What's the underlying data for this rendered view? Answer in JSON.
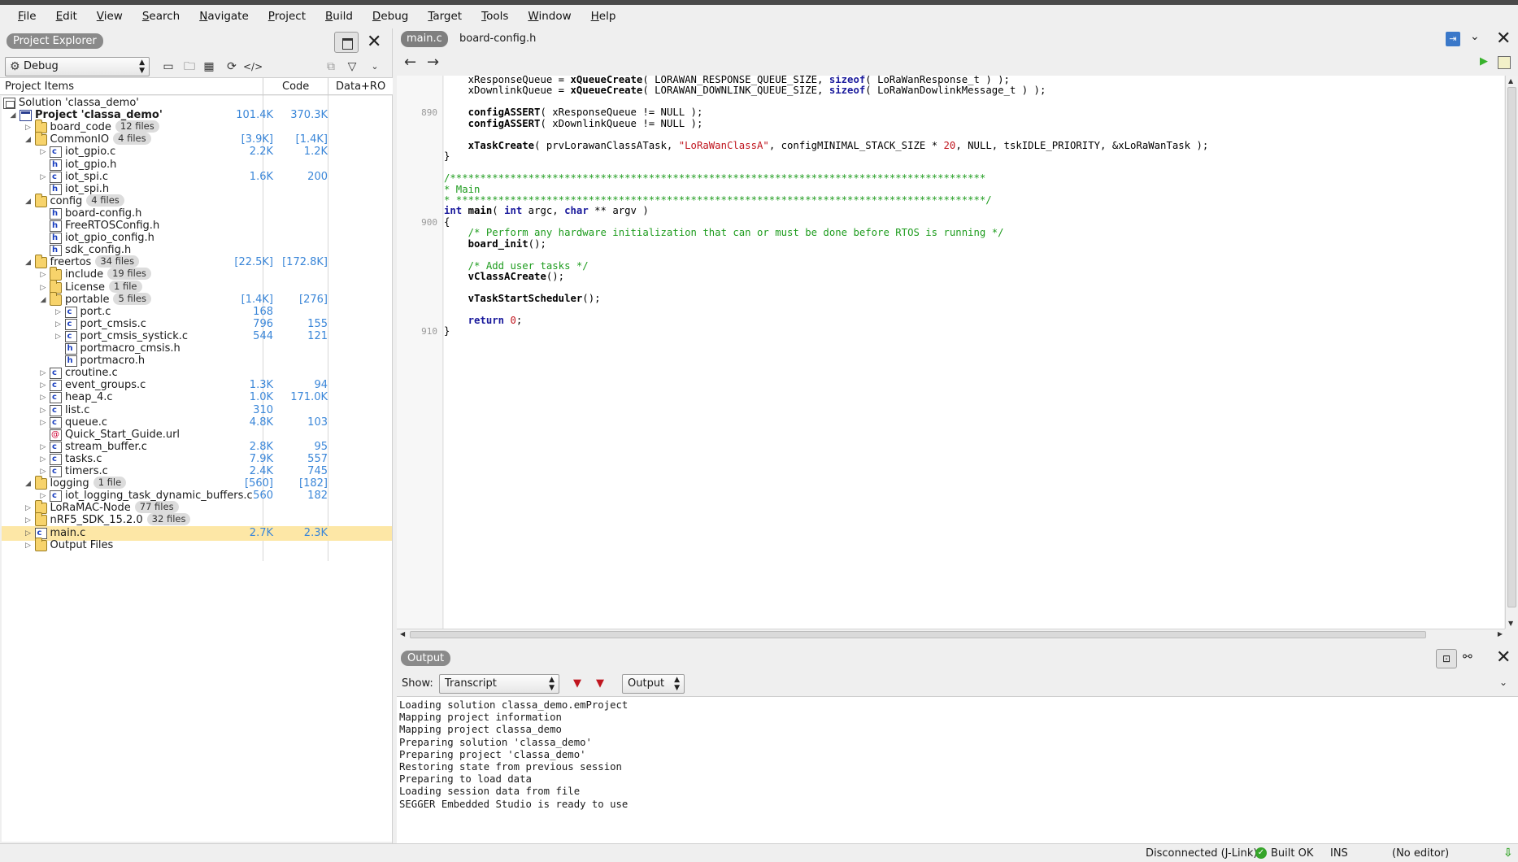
{
  "menu": [
    "File",
    "Edit",
    "View",
    "Search",
    "Navigate",
    "Project",
    "Build",
    "Debug",
    "Target",
    "Tools",
    "Window",
    "Help"
  ],
  "project_explorer": {
    "title": "Project Explorer",
    "configuration": "Debug",
    "columns": {
      "items": "Project Items",
      "code": "Code",
      "data": "Data+RO"
    },
    "tree": [
      {
        "name": "Solution 'classa_demo'",
        "level": 0,
        "icon": "solution-icon",
        "twisty": "",
        "badge": "",
        "code": "",
        "data": "",
        "bold": false
      },
      {
        "name": "Project 'classa_demo'",
        "level": 0,
        "icon": "project-icon",
        "twisty": "open",
        "badge": "",
        "code": "101.4K",
        "data": "370.3K",
        "bold": true
      },
      {
        "name": "board_code",
        "level": 1,
        "icon": "folder-icon",
        "twisty": "closed",
        "badge": "12 files",
        "code": "",
        "data": "",
        "bold": false
      },
      {
        "name": "CommonIO",
        "level": 1,
        "icon": "folder-icon",
        "twisty": "open",
        "badge": "4 files",
        "code": "[3.9K]",
        "data": "[1.4K]",
        "bold": false
      },
      {
        "name": "iot_gpio.c",
        "level": 2,
        "icon": "c-file-icon",
        "twisty": "closed",
        "badge": "",
        "code": "2.2K",
        "data": "1.2K",
        "bold": false
      },
      {
        "name": "iot_gpio.h",
        "level": 2,
        "icon": "h-file-icon",
        "twisty": "",
        "badge": "",
        "code": "",
        "data": "",
        "bold": false
      },
      {
        "name": "iot_spi.c",
        "level": 2,
        "icon": "c-file-icon",
        "twisty": "closed",
        "badge": "",
        "code": "1.6K",
        "data": "200",
        "bold": false
      },
      {
        "name": "iot_spi.h",
        "level": 2,
        "icon": "h-file-icon",
        "twisty": "",
        "badge": "",
        "code": "",
        "data": "",
        "bold": false
      },
      {
        "name": "config",
        "level": 1,
        "icon": "folder-icon",
        "twisty": "open",
        "badge": "4 files",
        "code": "",
        "data": "",
        "bold": false
      },
      {
        "name": "board-config.h",
        "level": 2,
        "icon": "h-file-icon",
        "twisty": "",
        "badge": "",
        "code": "",
        "data": "",
        "bold": false
      },
      {
        "name": "FreeRTOSConfig.h",
        "level": 2,
        "icon": "h-file-icon",
        "twisty": "",
        "badge": "",
        "code": "",
        "data": "",
        "bold": false
      },
      {
        "name": "iot_gpio_config.h",
        "level": 2,
        "icon": "h-file-icon",
        "twisty": "",
        "badge": "",
        "code": "",
        "data": "",
        "bold": false
      },
      {
        "name": "sdk_config.h",
        "level": 2,
        "icon": "h-file-icon",
        "twisty": "",
        "badge": "",
        "code": "",
        "data": "",
        "bold": false
      },
      {
        "name": "freertos",
        "level": 1,
        "icon": "folder-icon",
        "twisty": "open",
        "badge": "34 files",
        "code": "[22.5K]",
        "data": "[172.8K]",
        "bold": false
      },
      {
        "name": "include",
        "level": 2,
        "icon": "folder-icon",
        "twisty": "closed",
        "badge": "19 files",
        "code": "",
        "data": "",
        "bold": false
      },
      {
        "name": "License",
        "level": 2,
        "icon": "folder-icon",
        "twisty": "closed",
        "badge": "1 file",
        "code": "",
        "data": "",
        "bold": false
      },
      {
        "name": "portable",
        "level": 2,
        "icon": "folder-icon",
        "twisty": "open",
        "badge": "5 files",
        "code": "[1.4K]",
        "data": "[276]",
        "bold": false
      },
      {
        "name": "port.c",
        "level": 3,
        "icon": "c-file-icon",
        "twisty": "closed",
        "badge": "",
        "code": "168",
        "data": "",
        "bold": false
      },
      {
        "name": "port_cmsis.c",
        "level": 3,
        "icon": "c-file-icon",
        "twisty": "closed",
        "badge": "",
        "code": "796",
        "data": "155",
        "bold": false
      },
      {
        "name": "port_cmsis_systick.c",
        "level": 3,
        "icon": "c-file-icon",
        "twisty": "closed",
        "badge": "",
        "code": "544",
        "data": "121",
        "bold": false
      },
      {
        "name": "portmacro_cmsis.h",
        "level": 3,
        "icon": "h-file-icon",
        "twisty": "",
        "badge": "",
        "code": "",
        "data": "",
        "bold": false
      },
      {
        "name": "portmacro.h",
        "level": 3,
        "icon": "h-file-icon",
        "twisty": "",
        "badge": "",
        "code": "",
        "data": "",
        "bold": false
      },
      {
        "name": "croutine.c",
        "level": 2,
        "icon": "c-file-icon",
        "twisty": "closed",
        "badge": "",
        "code": "",
        "data": "",
        "bold": false
      },
      {
        "name": "event_groups.c",
        "level": 2,
        "icon": "c-file-icon",
        "twisty": "closed",
        "badge": "",
        "code": "1.3K",
        "data": "94",
        "bold": false
      },
      {
        "name": "heap_4.c",
        "level": 2,
        "icon": "c-file-icon",
        "twisty": "closed",
        "badge": "",
        "code": "1.0K",
        "data": "171.0K",
        "bold": false
      },
      {
        "name": "list.c",
        "level": 2,
        "icon": "c-file-icon",
        "twisty": "closed",
        "badge": "",
        "code": "310",
        "data": "",
        "bold": false
      },
      {
        "name": "queue.c",
        "level": 2,
        "icon": "c-file-icon",
        "twisty": "closed",
        "badge": "",
        "code": "4.8K",
        "data": "103",
        "bold": false
      },
      {
        "name": "Quick_Start_Guide.url",
        "level": 2,
        "icon": "url-file-icon",
        "twisty": "",
        "badge": "",
        "code": "",
        "data": "",
        "bold": false
      },
      {
        "name": "stream_buffer.c",
        "level": 2,
        "icon": "c-file-icon",
        "twisty": "closed",
        "badge": "",
        "code": "2.8K",
        "data": "95",
        "bold": false
      },
      {
        "name": "tasks.c",
        "level": 2,
        "icon": "c-file-icon",
        "twisty": "closed",
        "badge": "",
        "code": "7.9K",
        "data": "557",
        "bold": false
      },
      {
        "name": "timers.c",
        "level": 2,
        "icon": "c-file-icon",
        "twisty": "closed",
        "badge": "",
        "code": "2.4K",
        "data": "745",
        "bold": false
      },
      {
        "name": "logging",
        "level": 1,
        "icon": "folder-icon",
        "twisty": "open",
        "badge": "1 file",
        "code": "[560]",
        "data": "[182]",
        "bold": false
      },
      {
        "name": "iot_logging_task_dynamic_buffers.c",
        "level": 2,
        "icon": "c-file-icon",
        "twisty": "closed",
        "badge": "",
        "code": "560",
        "data": "182",
        "bold": false
      },
      {
        "name": "LoRaMAC-Node",
        "level": 1,
        "icon": "folder-icon",
        "twisty": "closed",
        "badge": "77 files",
        "code": "",
        "data": "",
        "bold": false
      },
      {
        "name": "nRF5_SDK_15.2.0",
        "level": 1,
        "icon": "folder-icon",
        "twisty": "closed",
        "badge": "32 files",
        "code": "",
        "data": "",
        "bold": false
      },
      {
        "name": "main.c",
        "level": 1,
        "icon": "c-file-icon",
        "twisty": "closed",
        "badge": "",
        "code": "2.7K",
        "data": "2.3K",
        "bold": false,
        "selected": true
      },
      {
        "name": "Output Files",
        "level": 1,
        "icon": "folder-icon",
        "twisty": "closed",
        "badge": "",
        "code": "",
        "data": "",
        "bold": false
      }
    ]
  },
  "editor": {
    "tabs": [
      "main.c",
      "board-config.h"
    ],
    "active_tab": "main.c",
    "line_numbers": [
      {
        "row": 3,
        "n": "890"
      },
      {
        "row": 13,
        "n": "900"
      },
      {
        "row": 23,
        "n": "910"
      }
    ],
    "lines": [
      [
        [
          "    xResponseQueue = ",
          ""
        ],
        [
          "xQueueCreate",
          "fn"
        ],
        [
          "( LORAWAN_RESPONSE_QUEUE_SIZE, ",
          ""
        ],
        [
          "sizeof",
          "kw"
        ],
        [
          "( LoRaWanResponse_t ) );",
          ""
        ]
      ],
      [
        [
          "    xDownlinkQueue = ",
          ""
        ],
        [
          "xQueueCreate",
          "fn"
        ],
        [
          "( LORAWAN_DOWNLINK_QUEUE_SIZE, ",
          ""
        ],
        [
          "sizeof",
          "kw"
        ],
        [
          "( LoRaWanDowlinkMessage_t ) );",
          ""
        ]
      ],
      [],
      [
        [
          "    ",
          ""
        ],
        [
          "configASSERT",
          "fn"
        ],
        [
          "( xResponseQueue != NULL );",
          ""
        ]
      ],
      [
        [
          "    ",
          ""
        ],
        [
          "configASSERT",
          "fn"
        ],
        [
          "( xDownlinkQueue != NULL );",
          ""
        ]
      ],
      [],
      [
        [
          "    ",
          ""
        ],
        [
          "xTaskCreate",
          "fn"
        ],
        [
          "( prvLorawanClassATask, ",
          ""
        ],
        [
          "\"LoRaWanClassA\"",
          "str"
        ],
        [
          ", configMINIMAL_STACK_SIZE * ",
          ""
        ],
        [
          "20",
          "num"
        ],
        [
          ", NULL, tskIDLE_PRIORITY, &xLoRaWanTask );",
          ""
        ]
      ],
      [
        [
          "}",
          ""
        ]
      ],
      [],
      [
        [
          "/*****************************************************************************************",
          "cm"
        ]
      ],
      [
        [
          "* Main",
          "cm"
        ]
      ],
      [
        [
          "* ****************************************************************************************/",
          "cm"
        ]
      ],
      [
        [
          "int",
          "kw"
        ],
        [
          " ",
          ""
        ],
        [
          "main",
          "fn"
        ],
        [
          "( ",
          ""
        ],
        [
          "int",
          "kw"
        ],
        [
          " argc, ",
          ""
        ],
        [
          "char",
          "kw"
        ],
        [
          " ** argv )",
          ""
        ]
      ],
      [
        [
          "{",
          ""
        ]
      ],
      [
        [
          "    ",
          ""
        ],
        [
          "/* Perform any hardware initialization that can or must be done before RTOS is running */",
          "cm"
        ]
      ],
      [
        [
          "    ",
          ""
        ],
        [
          "board_init",
          "fn"
        ],
        [
          "();",
          ""
        ]
      ],
      [],
      [
        [
          "    ",
          ""
        ],
        [
          "/* Add user tasks */",
          "cm"
        ]
      ],
      [
        [
          "    ",
          ""
        ],
        [
          "vClassACreate",
          "fn"
        ],
        [
          "();",
          ""
        ]
      ],
      [],
      [
        [
          "    ",
          ""
        ],
        [
          "vTaskStartScheduler",
          "fn"
        ],
        [
          "();",
          ""
        ]
      ],
      [],
      [
        [
          "    ",
          ""
        ],
        [
          "return",
          "kw"
        ],
        [
          " ",
          ""
        ],
        [
          "0",
          "num"
        ],
        [
          ";",
          ""
        ]
      ],
      [
        [
          "}",
          ""
        ]
      ]
    ]
  },
  "output": {
    "title": "Output",
    "show_label": "Show:",
    "show_value": "Transcript",
    "target_value": "Output",
    "lines": [
      "Loading solution classa_demo.emProject",
      "Mapping project information",
      "Mapping project classa_demo",
      "Preparing solution 'classa_demo'",
      "Preparing project 'classa_demo'",
      "Restoring state from previous session",
      "Preparing to load data",
      "Loading session data from file",
      "SEGGER Embedded Studio is ready to use"
    ]
  },
  "status": {
    "connection": "Disconnected (J-Link)",
    "build": "Built OK",
    "mode": "INS",
    "editor": "(No editor)"
  },
  "colors": {
    "selection": "#fde7a6",
    "size_value": "#3a86d8",
    "keyword": "#1a1a9c",
    "string": "#c0161f",
    "comment": "#1e9c1e",
    "ok_green": "#36a52a"
  }
}
